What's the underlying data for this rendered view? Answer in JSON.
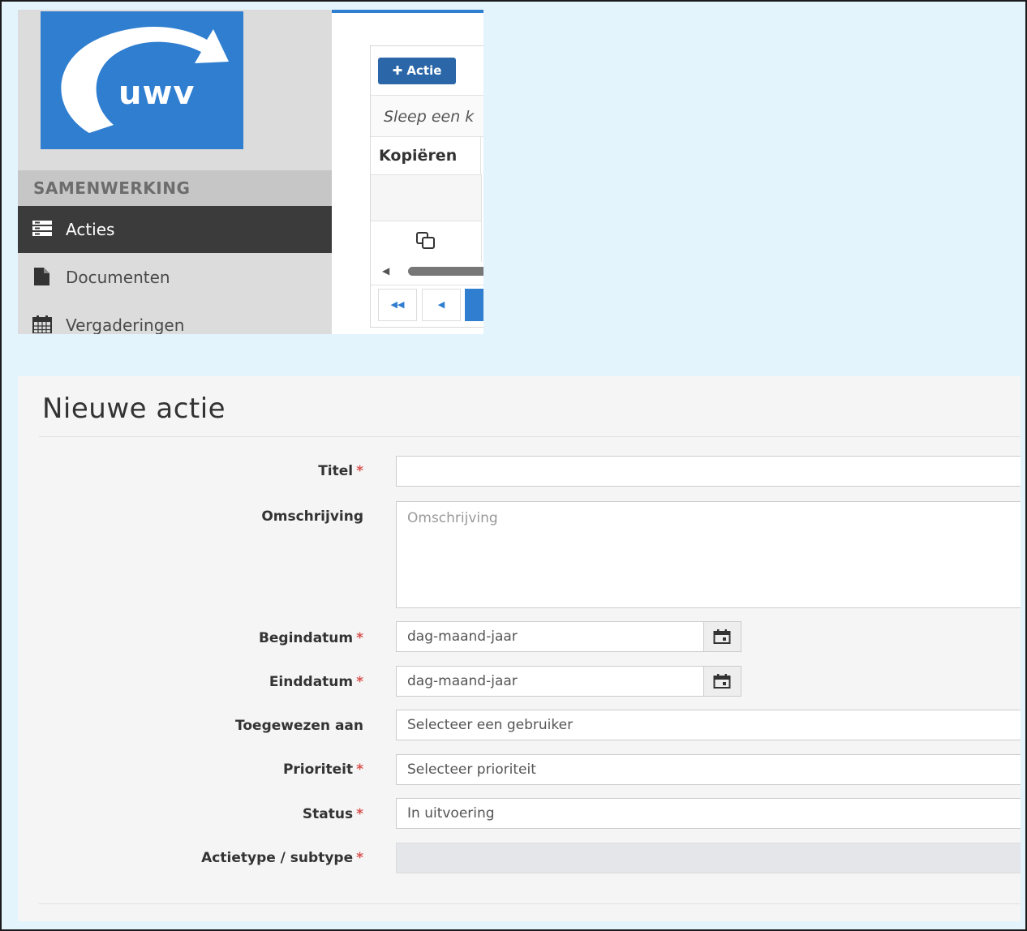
{
  "app": {
    "logo_text": "uwv",
    "accent_color": "#2f7ed0",
    "dark_nav_color": "#3b3b3b"
  },
  "sidebar": {
    "section_heading": "SAMENWERKING",
    "items": [
      {
        "label": "Acties",
        "icon": "list-icon",
        "active": true
      },
      {
        "label": "Documenten",
        "icon": "document-icon",
        "active": false
      },
      {
        "label": "Vergaderingen",
        "icon": "calendar-icon",
        "active": false
      }
    ]
  },
  "grid": {
    "add_button_label": "✚ Actie",
    "drag_hint": "Sleep een k",
    "column_header": "Kopiëren",
    "copy_icon": "copy-icon",
    "pager_first": "◀◀",
    "pager_prev": "◀"
  },
  "form": {
    "title": "Nieuwe actie",
    "required_marker": "*",
    "fields": {
      "titel": {
        "label": "Titel",
        "value": ""
      },
      "omschrijving": {
        "label": "Omschrijving",
        "placeholder": "Omschrijving"
      },
      "begindatum": {
        "label": "Begindatum",
        "placeholder": "dag-maand-jaar"
      },
      "einddatum": {
        "label": "Einddatum",
        "placeholder": "dag-maand-jaar"
      },
      "toegewezen": {
        "label": "Toegewezen aan",
        "placeholder": "Selecteer een gebruiker"
      },
      "prioriteit": {
        "label": "Prioriteit",
        "placeholder": "Selecteer prioriteit"
      },
      "status": {
        "label": "Status",
        "value": "In uitvoering"
      },
      "actietype": {
        "label": "Actietype / subtype"
      }
    }
  }
}
